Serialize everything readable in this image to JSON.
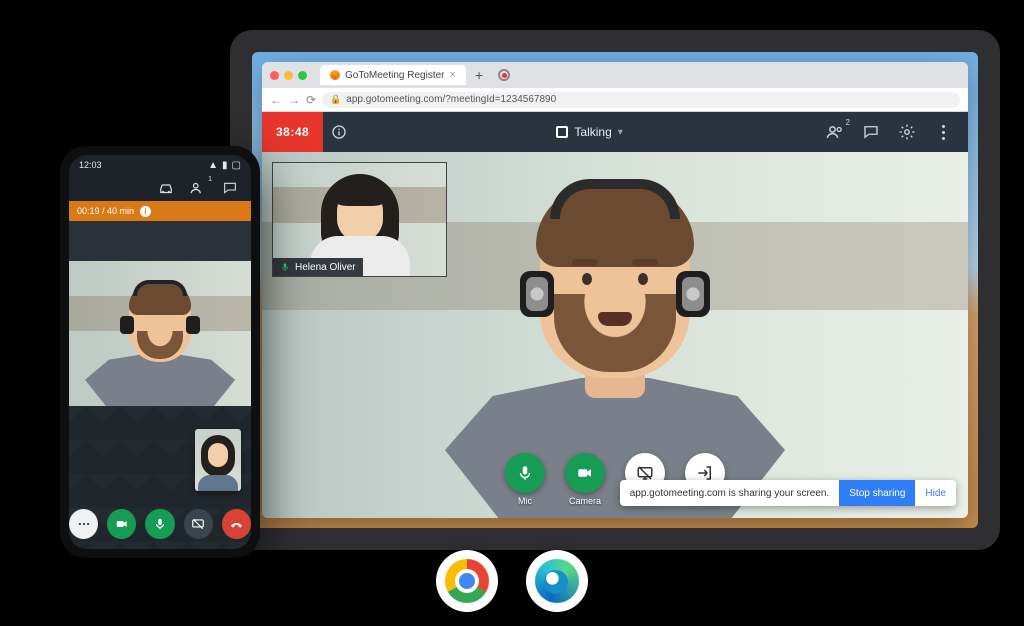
{
  "laptop": {
    "browser": {
      "tab_title": "GoToMeeting Register",
      "url": "app.gotomeeting.com/?meetingId=1234567890"
    },
    "toolbar": {
      "timer": "38:48",
      "talking_label": "Talking",
      "participants_count": "2"
    },
    "pip": {
      "name": "Helena Oliver"
    },
    "controls": {
      "mic": "Mic",
      "camera": "Camera",
      "screen": "Screen",
      "leave": "Leave"
    },
    "share_toast": {
      "message": "app.gotomeeting.com is sharing your screen.",
      "stop": "Stop sharing",
      "hide": "Hide"
    }
  },
  "phone": {
    "status": {
      "time": "12:03"
    },
    "participants_count": "1",
    "timer": "00:19 / 40 min"
  },
  "badges": {
    "chrome": "Chrome",
    "edge": "Microsoft Edge"
  }
}
